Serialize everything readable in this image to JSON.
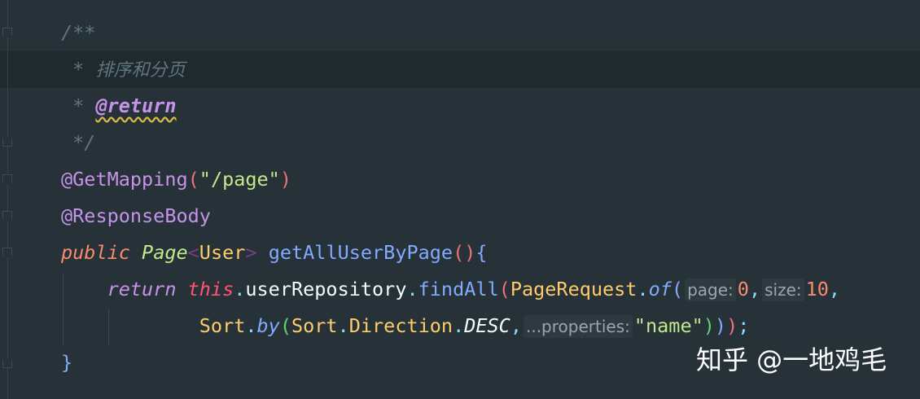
{
  "code_lines": [
    [
      {
        "t": "/**",
        "c": "comment"
      }
    ],
    [
      {
        "t": " * ",
        "c": "comment"
      },
      {
        "t": "排序和分页",
        "c": "cn"
      }
    ],
    [
      {
        "t": " * ",
        "c": "comment"
      },
      {
        "t": "@return",
        "c": "tag"
      }
    ],
    [
      {
        "t": " */",
        "c": "comment"
      }
    ],
    [
      {
        "t": "@GetMapping",
        "c": "ann"
      },
      {
        "t": "(",
        "c": "pink"
      },
      {
        "t": "\"/page\"",
        "c": "str"
      },
      {
        "t": ")",
        "c": "pink"
      }
    ],
    [
      {
        "t": "@ResponseBody",
        "c": "ann"
      }
    ],
    [
      {
        "t": "public",
        "c": "kw"
      },
      {
        "t": " ",
        "c": "plain"
      },
      {
        "t": "Page",
        "c": "type"
      },
      {
        "t": "<",
        "c": "angle"
      },
      {
        "t": "User",
        "c": "cls"
      },
      {
        "t": ">",
        "c": "angle"
      },
      {
        "t": " ",
        "c": "plain"
      },
      {
        "t": "getAllUserByPage",
        "c": "fn"
      },
      {
        "t": "()",
        "c": "pink"
      },
      {
        "t": "{",
        "c": "blue"
      }
    ],
    [
      {
        "t": "    ",
        "c": "plain"
      },
      {
        "t": "return",
        "c": "ret"
      },
      {
        "t": " ",
        "c": "plain"
      },
      {
        "t": "this",
        "c": "this"
      },
      {
        "t": ".",
        "c": "punc"
      },
      {
        "t": "userRepository",
        "c": "plain"
      },
      {
        "t": ".",
        "c": "punc"
      },
      {
        "t": "findAll",
        "c": "fn"
      },
      {
        "t": "(",
        "c": "pink"
      },
      {
        "t": "PageRequest",
        "c": "cls"
      },
      {
        "t": ".",
        "c": "punc"
      },
      {
        "t": "of",
        "c": "fni"
      },
      {
        "t": "(",
        "c": "blue"
      },
      {
        "t": "page:",
        "c": "hint"
      },
      {
        "t": "0",
        "c": "num"
      },
      {
        "t": ",",
        "c": "punc"
      },
      {
        "t": "size:",
        "c": "hint"
      },
      {
        "t": "10",
        "c": "num"
      },
      {
        "t": ",",
        "c": "punc"
      }
    ],
    [
      {
        "t": "            ",
        "c": "plain"
      },
      {
        "t": "Sort",
        "c": "cls"
      },
      {
        "t": ".",
        "c": "punc"
      },
      {
        "t": "by",
        "c": "fni"
      },
      {
        "t": "(",
        "c": "green"
      },
      {
        "t": "Sort",
        "c": "cls"
      },
      {
        "t": ".",
        "c": "punc"
      },
      {
        "t": "Direction",
        "c": "cls"
      },
      {
        "t": ".",
        "c": "punc"
      },
      {
        "t": "DESC",
        "c": "const"
      },
      {
        "t": ",",
        "c": "punc"
      },
      {
        "t": "...properties:",
        "c": "hint"
      },
      {
        "t": "\"name\"",
        "c": "str"
      },
      {
        "t": ")",
        "c": "green"
      },
      {
        "t": ")",
        "c": "blue"
      },
      {
        "t": ")",
        "c": "pink"
      },
      {
        "t": ";",
        "c": "punc"
      }
    ],
    [
      {
        "t": "}",
        "c": "blue"
      }
    ]
  ],
  "watermark": "知乎 @一地鸡毛"
}
